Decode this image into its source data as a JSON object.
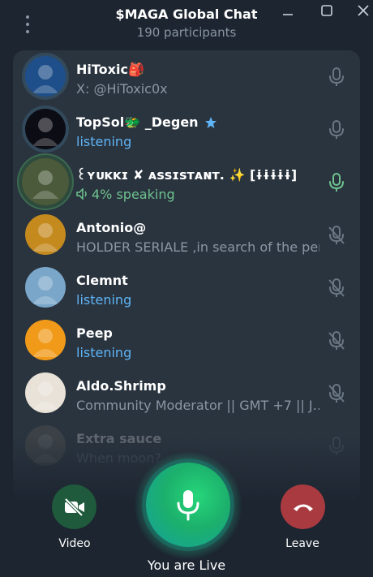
{
  "header": {
    "title": "$MAGA Global Chat",
    "subtitle": "190 participants"
  },
  "participants": [
    {
      "name": "HiToxic🎒",
      "status": "X: @HiToxic0x",
      "status_style": "muted",
      "mic": "on",
      "avatar_color": "#1e4f8a"
    },
    {
      "name": "TopSol🐲 _Degen",
      "status": "listening",
      "status_style": "blue",
      "mic": "on",
      "verified": true,
      "avatar_color": "#0c0c14"
    },
    {
      "name": "꒰ʏᴜᴋᴋɪ ✘ ᴀssɪsᴛᴀɴᴛ. ✨ [ɨɨɨɨɨ]",
      "status": "4% speaking",
      "status_style": "green",
      "mic": "speaking",
      "avatar_color": "#4a5a3a"
    },
    {
      "name": "Antonio@",
      "status": "HOLDER SERIALE ,in search of the perfect…",
      "status_style": "muted",
      "mic": "muted",
      "avatar_color": "#c58a1e"
    },
    {
      "name": "Clemnt",
      "status": "listening",
      "status_style": "blue",
      "mic": "muted",
      "avatar_color": "#7aa7c9"
    },
    {
      "name": "Peep",
      "status": "listening",
      "status_style": "blue",
      "mic": "muted",
      "avatar_color": "#f19a1a"
    },
    {
      "name": "Aldo.Shrimp",
      "status": "Community Moderator || GMT +7 || J…",
      "status_style": "muted",
      "mic": "muted",
      "avatar_color": "#e8e2d8"
    },
    {
      "name": "Extra sauce",
      "status": "When moon?",
      "status_style": "muted",
      "mic": "on",
      "avatar_color": "#6d6a5e"
    }
  ],
  "controls": {
    "video_label": "Video",
    "leave_label": "Leave",
    "live_label": "You are Live"
  },
  "colors": {
    "speaking": "#6ec38f",
    "listening": "#5eb5f7",
    "video_button": "#1f5a3c",
    "leave_button": "#a83a40",
    "live_button": "#1cb06c"
  }
}
